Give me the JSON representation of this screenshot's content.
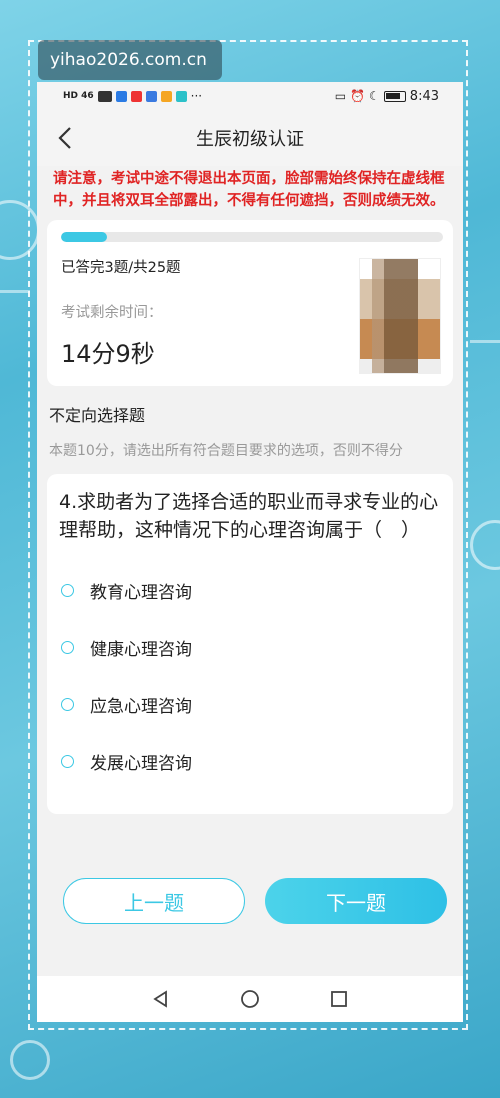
{
  "watermark": "yihao2026.com.cn",
  "statusbar": {
    "signal": "HD 46",
    "time": "8:43"
  },
  "header": {
    "title": "生辰初级认证"
  },
  "warning": "请注意，考试中途不得退出本页面，脸部需始终保持在虚线框中，并且将双耳全部露出，不得有任何遮挡，否则成绩无效。",
  "exam": {
    "progress_percent": 12,
    "answered_text": "已答完3题/共25题",
    "remain_label": "考试剩余时间：",
    "remain_time": "14分9秒"
  },
  "section": {
    "title": "不定向选择题",
    "note": "本题10分，请选出所有符合题目要求的选项，否则不得分"
  },
  "question": {
    "text": "4.求助者为了选择合适的职业而寻求专业的心理帮助，这种情况下的心理咨询属于（　）",
    "options": [
      "教育心理咨询",
      "健康心理咨询",
      "应急心理咨询",
      "发展心理咨询"
    ]
  },
  "buttons": {
    "prev": "上一题",
    "next": "下一题"
  },
  "colors": {
    "accent": "#3cc8e4",
    "warning": "#e02424"
  }
}
